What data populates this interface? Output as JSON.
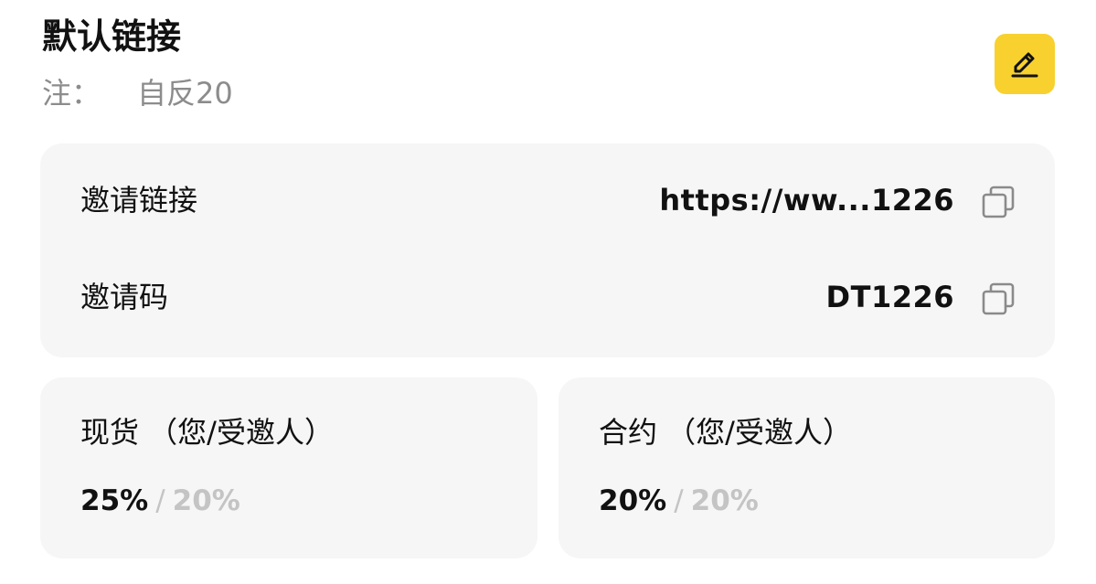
{
  "header": {
    "title": "默认链接",
    "note_label": "注：",
    "note_value": "自反20"
  },
  "icons": {
    "edit": "pencil-icon",
    "copy": "copy-icon"
  },
  "colors": {
    "accent": "#f8d12f",
    "card_bg": "#f6f6f6",
    "muted_text": "#8c8c8c",
    "secondary_value": "#c4c4c4"
  },
  "invite": {
    "link_label": "邀请链接",
    "link_value": "https://ww...1226",
    "code_label": "邀请码",
    "code_value": "DT1226"
  },
  "rates": {
    "spot": {
      "title": "现货 （您/受邀人）",
      "mine": "25%",
      "separator": "/",
      "invitee": "20%"
    },
    "futures": {
      "title": "合约 （您/受邀人）",
      "mine": "20%",
      "separator": "/",
      "invitee": "20%"
    }
  }
}
